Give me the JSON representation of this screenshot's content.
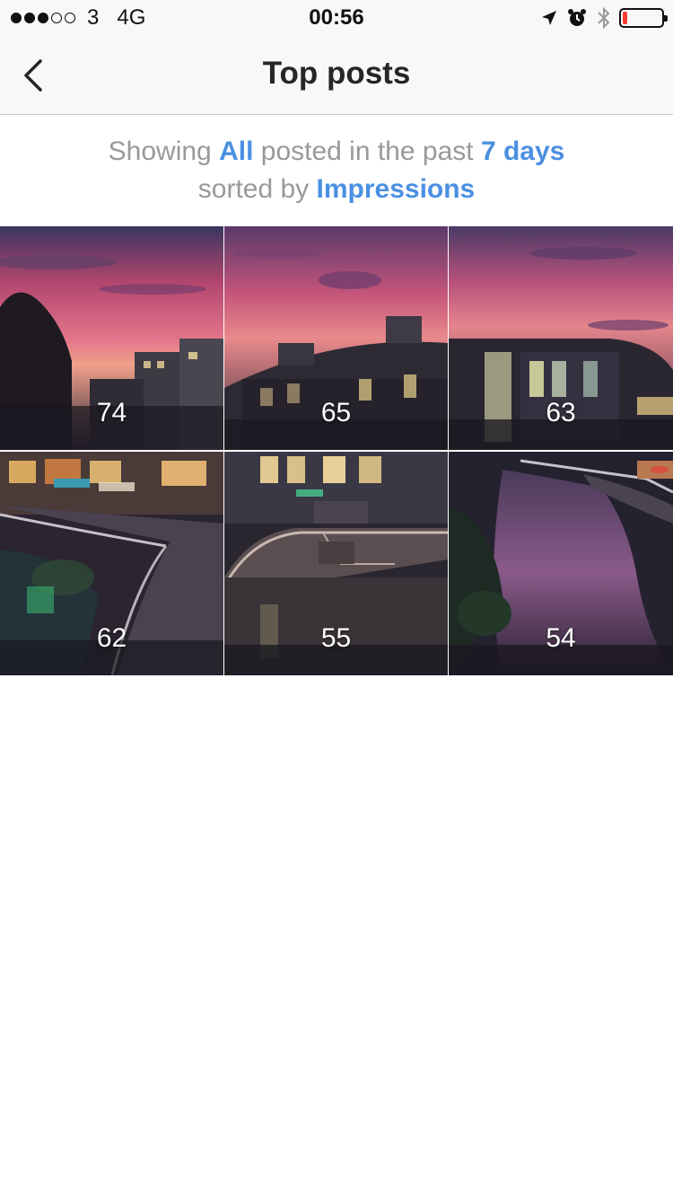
{
  "status_bar": {
    "carrier": "3",
    "network": "4G",
    "time": "00:56",
    "signal_strength": 3,
    "signal_max": 5,
    "battery_level": 0.12,
    "battery_color": "#ff3b30",
    "icons": [
      "location-arrow-icon",
      "alarm-icon",
      "bluetooth-icon",
      "battery-icon"
    ]
  },
  "nav": {
    "title": "Top posts",
    "back_icon": "chevron-left-icon"
  },
  "summary": {
    "prefix": "Showing ",
    "filter": "All",
    "middle": " posted in the past ",
    "period": "7 days",
    "sort_prefix": "sorted by ",
    "sort_metric": "Impressions",
    "link_color": "#4a90e2"
  },
  "posts": [
    {
      "count": "74",
      "scene": "sunset-trees-buildings"
    },
    {
      "count": "65",
      "scene": "sunset-curved-building"
    },
    {
      "count": "63",
      "scene": "sunset-glass-building"
    },
    {
      "count": "62",
      "scene": "riverside-restaurants-byron"
    },
    {
      "count": "55",
      "scene": "bridge-stairs-walkway"
    },
    {
      "count": "54",
      "scene": "river-reflection"
    }
  ]
}
